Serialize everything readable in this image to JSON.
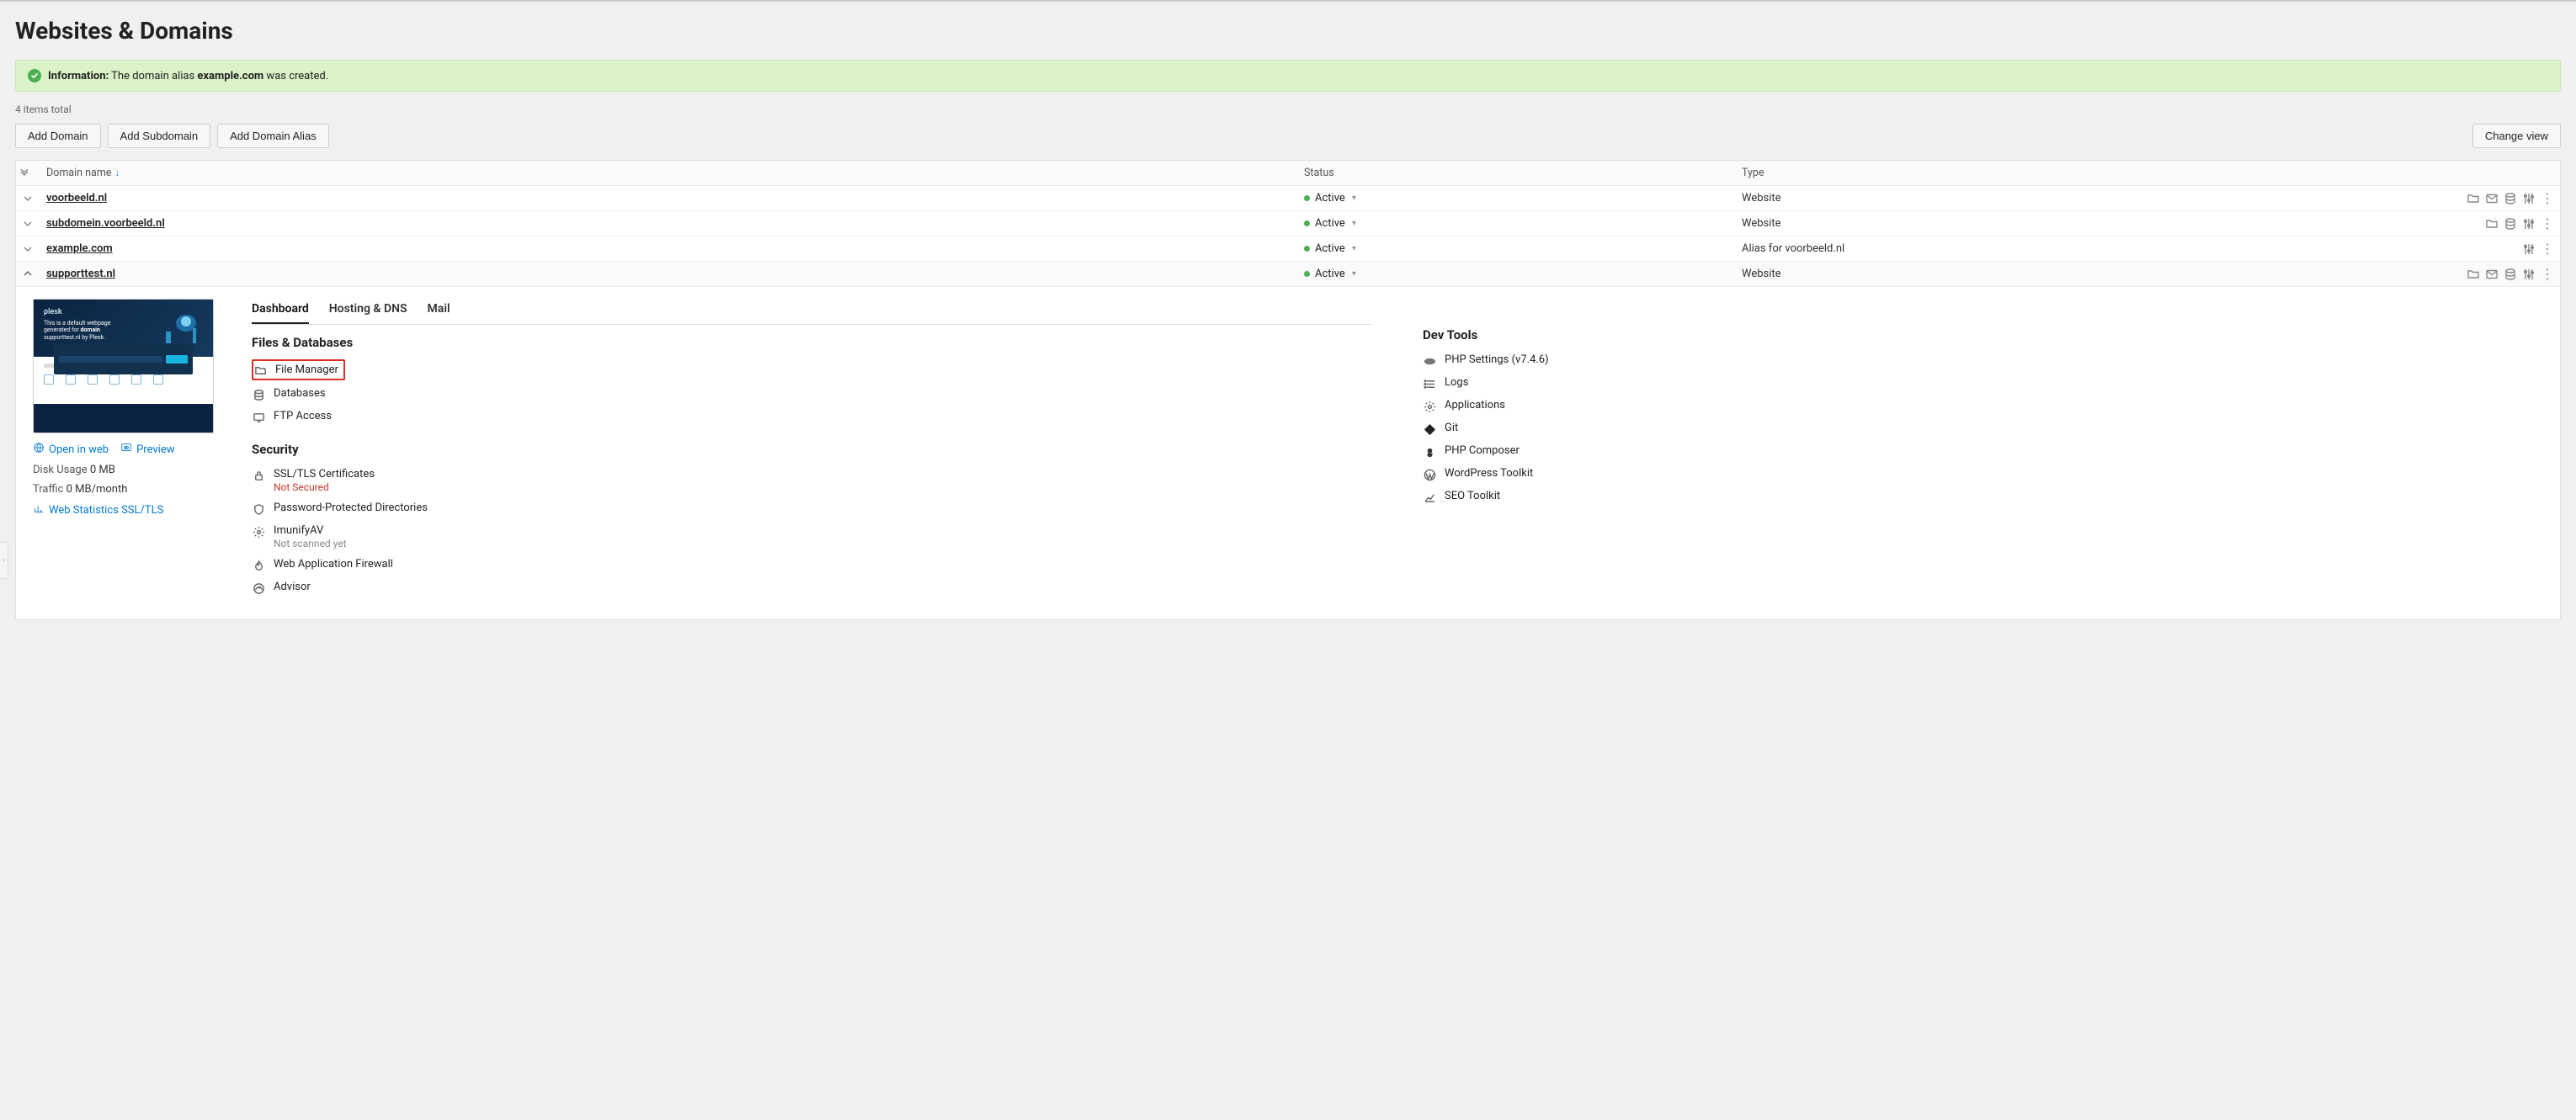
{
  "page_title": "Websites & Domains",
  "alert": {
    "label": "Information:",
    "before": "The domain alias",
    "domain": "example.com",
    "after": "was created."
  },
  "items_total": "4 items total",
  "toolbar": {
    "add_domain": "Add Domain",
    "add_subdomain": "Add Subdomain",
    "add_alias": "Add Domain Alias",
    "change_view": "Change view"
  },
  "columns": {
    "domain": "Domain name",
    "sort_indicator": "↓",
    "status": "Status",
    "type": "Type"
  },
  "rows": [
    {
      "expanded": false,
      "domain": "voorbeeld.nl",
      "status": "Active",
      "type": "Website",
      "actions": [
        "folder",
        "mail",
        "db",
        "sliders",
        "more"
      ]
    },
    {
      "expanded": false,
      "domain": "subdomein.voorbeeld.nl",
      "status": "Active",
      "type": "Website",
      "actions": [
        "folder",
        "db",
        "sliders",
        "more"
      ]
    },
    {
      "expanded": false,
      "domain": "example.com",
      "status": "Active",
      "type": "Alias for voorbeeld.nl",
      "actions": [
        "sliders",
        "more"
      ]
    },
    {
      "expanded": true,
      "domain": "supporttest.nl",
      "status": "Active",
      "type": "Website",
      "actions": [
        "folder",
        "mail",
        "db",
        "sliders",
        "more"
      ]
    }
  ],
  "detail": {
    "tabs": [
      "Dashboard",
      "Hosting & DNS",
      "Mail"
    ],
    "active_tab": 0,
    "preview": {
      "open_in_web": "Open in web",
      "preview_label": "Preview",
      "disk_usage_label": "Disk Usage",
      "disk_usage_value": "0 MB",
      "traffic_label": "Traffic",
      "traffic_value": "0 MB/month",
      "stats_link": "Web Statistics SSL/TLS"
    },
    "sections": {
      "files_db": {
        "title": "Files & Databases",
        "items": [
          {
            "icon": "folder",
            "label": "File Manager",
            "highlight": true
          },
          {
            "icon": "db",
            "label": "Databases"
          },
          {
            "icon": "monitor",
            "label": "FTP Access"
          }
        ]
      },
      "security": {
        "title": "Security",
        "items": [
          {
            "icon": "lock",
            "label": "SSL/TLS Certificates",
            "sub": "Not Secured",
            "sub_style": "red"
          },
          {
            "icon": "shield",
            "label": "Password-Protected Directories"
          },
          {
            "icon": "gear",
            "label": "ImunifyAV",
            "sub": "Not scanned yet",
            "sub_style": "gray"
          },
          {
            "icon": "flame",
            "label": "Web Application Firewall"
          },
          {
            "icon": "advisor",
            "label": "Advisor"
          }
        ]
      },
      "dev_tools": {
        "title": "Dev Tools",
        "items": [
          {
            "icon": "php",
            "label": "PHP Settings (v7.4.6)"
          },
          {
            "icon": "list",
            "label": "Logs"
          },
          {
            "icon": "gear",
            "label": "Applications"
          },
          {
            "icon": "git",
            "label": "Git"
          },
          {
            "icon": "composer",
            "label": "PHP Composer"
          },
          {
            "icon": "wp",
            "label": "WordPress Toolkit"
          },
          {
            "icon": "chart",
            "label": "SEO Toolkit"
          }
        ]
      }
    }
  }
}
